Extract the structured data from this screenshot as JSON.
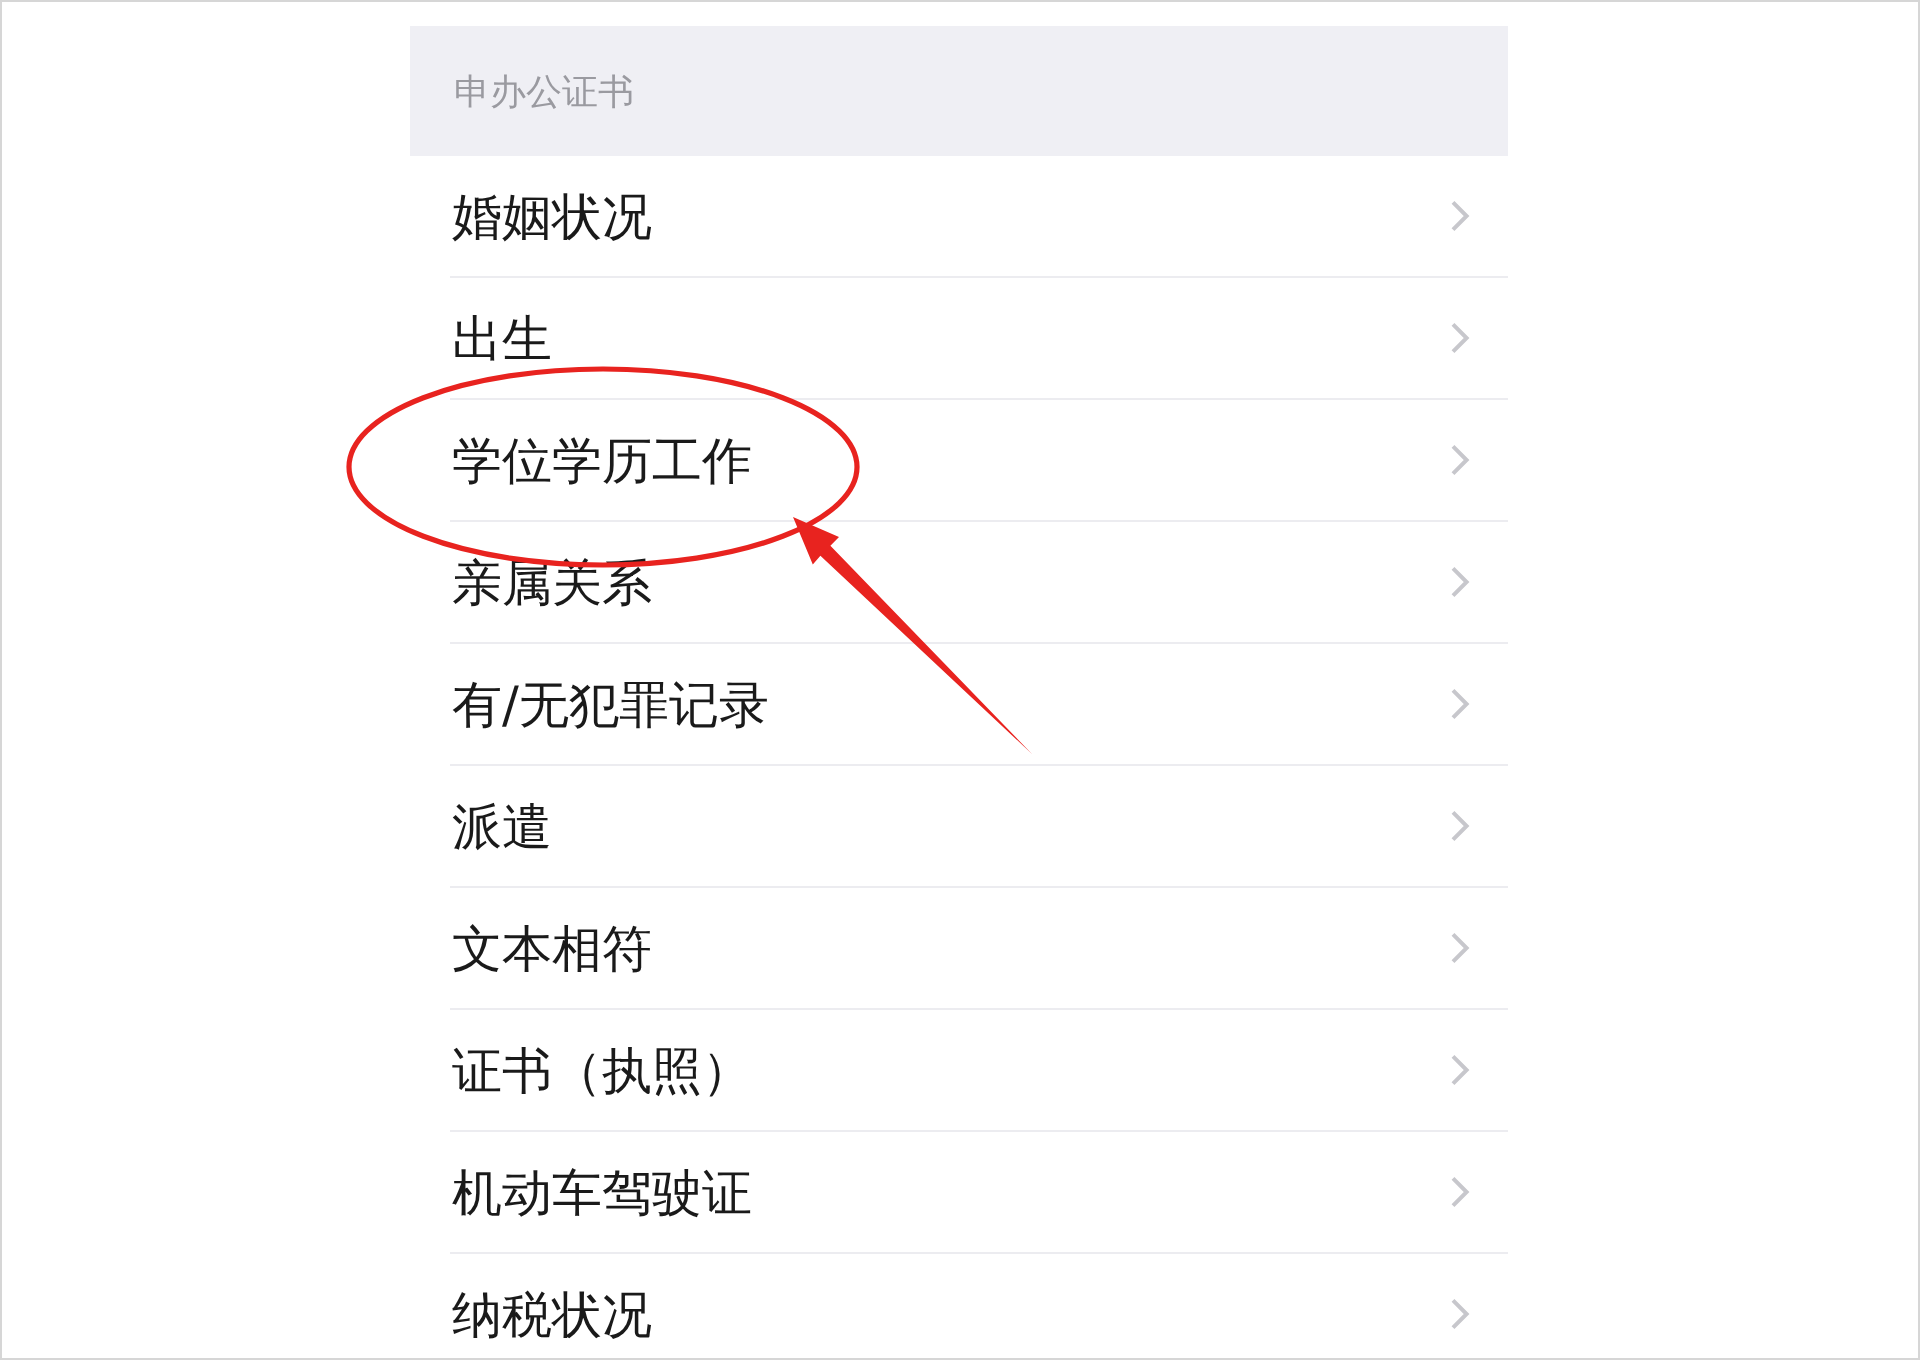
{
  "section": {
    "title": "申办公证书"
  },
  "items": [
    {
      "label": "婚姻状况",
      "circled": false
    },
    {
      "label": "出生",
      "circled": false
    },
    {
      "label": "学位学历工作",
      "circled": true
    },
    {
      "label": "亲属关系",
      "circled": false
    },
    {
      "label": "有/无犯罪记录",
      "circled": false
    },
    {
      "label": "派遣",
      "circled": false
    },
    {
      "label": "文本相符",
      "circled": false
    },
    {
      "label": "证书（执照）",
      "circled": false
    },
    {
      "label": "机动车驾驶证",
      "circled": false
    },
    {
      "label": "纳税状况",
      "circled": false
    }
  ]
}
